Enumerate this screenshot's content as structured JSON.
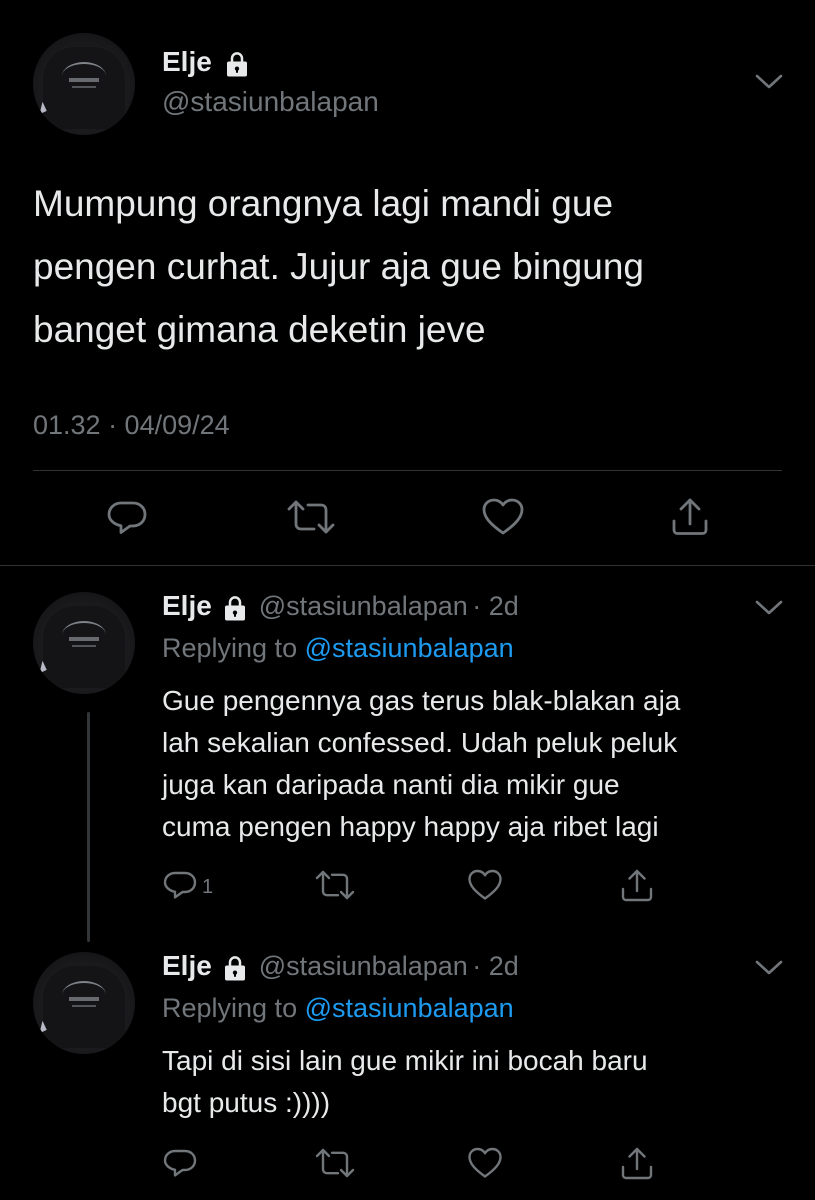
{
  "main_tweet": {
    "name": "Elje",
    "handle": "@stasiunbalapan",
    "text_lines": [
      "Mumpung orangnya lagi mandi gue",
      "pengen curhat. Jujur aja gue bingung",
      "banget gimana deketin jeve"
    ],
    "timestamp": "01.32 · 04/09/24",
    "actions": [
      "reply-icon",
      "retweet-icon",
      "like-icon",
      "share-icon"
    ]
  },
  "replies": [
    {
      "name": "Elje",
      "handle": "@stasiunbalapan",
      "time": "· 2d",
      "replying_label": "Replying to",
      "replying_handle": "@stasiunbalapan",
      "text_lines": [
        "Gue pengennya gas terus blak-blakan aja",
        "lah sekalian confessed. Udah peluk peluk",
        "juga kan daripada nanti dia mikir gue",
        "cuma pengen happy happy aja ribet lagi"
      ],
      "reply_count": "1"
    },
    {
      "name": "Elje",
      "handle": "@stasiunbalapan",
      "time": "· 2d",
      "replying_label": "Replying to",
      "replying_handle": "@stasiunbalapan",
      "text_lines": [
        "Tapi di sisi lain gue mikir ini bocah baru",
        "bgt putus :))))"
      ],
      "reply_count": ""
    }
  ],
  "colors": {
    "background": "#000000",
    "text": "#e7e9ea",
    "secondary": "#71767b",
    "link": "#1d9bf0",
    "divider": "#2f3336"
  }
}
